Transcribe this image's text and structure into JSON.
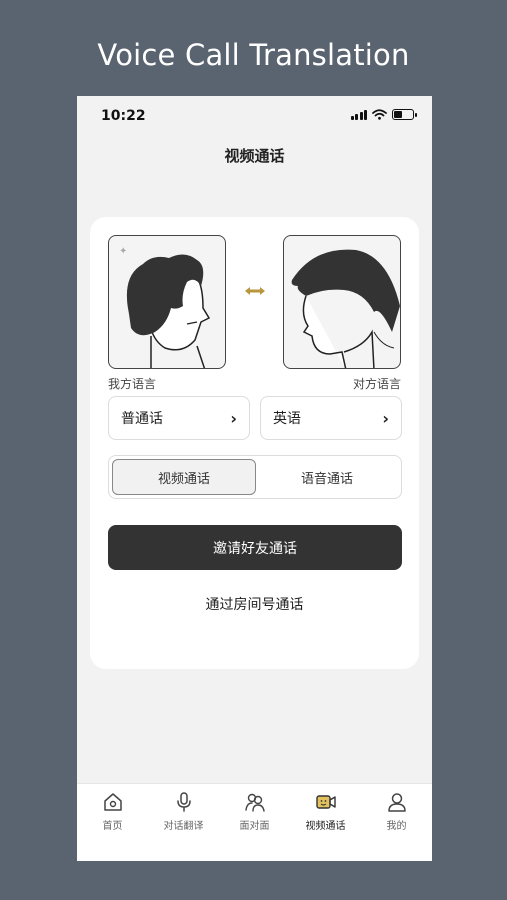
{
  "promo": {
    "title": "Voice Call Translation"
  },
  "status_bar": {
    "time": "10:22",
    "battery_level": 0.45
  },
  "nav": {
    "title": "视频通话"
  },
  "languages": {
    "mine_caption": "我方语言",
    "theirs_caption": "对方语言",
    "mine_value": "普通话",
    "theirs_value": "英语",
    "chevron": "›"
  },
  "call_type": {
    "options": [
      "视频通话",
      "语音通话"
    ],
    "selected": "视频通话"
  },
  "actions": {
    "invite_label": "邀请好友通话",
    "room_label": "通过房间号通话"
  },
  "tabbar": {
    "items": [
      {
        "label": "首页",
        "icon": "home-icon",
        "active": false
      },
      {
        "label": "对话翻译",
        "icon": "microphone-icon",
        "active": false
      },
      {
        "label": "面对面",
        "icon": "face-to-face-icon",
        "active": false
      },
      {
        "label": "视频通话",
        "icon": "video-call-icon",
        "active": true
      },
      {
        "label": "我的",
        "icon": "profile-icon",
        "active": false
      }
    ]
  },
  "colors": {
    "background": "#5a6370",
    "accent_gold": "#b8963e",
    "button_dark": "#333333"
  }
}
